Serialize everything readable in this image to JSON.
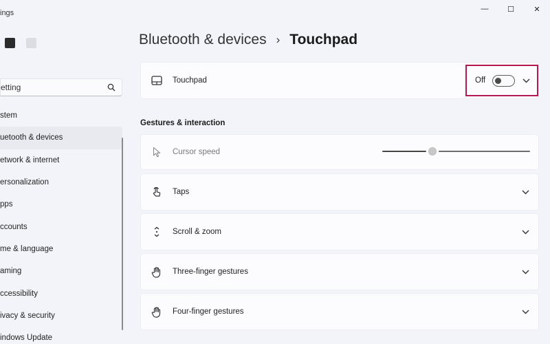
{
  "window": {
    "title": "ings",
    "controls": {
      "minimize": "—",
      "maximize": "☐",
      "close": "✕"
    }
  },
  "search": {
    "value": "etting",
    "icon": "search-icon"
  },
  "sidebar": {
    "items": [
      {
        "label": "stem",
        "selected": false
      },
      {
        "label": "uetooth & devices",
        "selected": true
      },
      {
        "label": "etwork & internet",
        "selected": false
      },
      {
        "label": "ersonalization",
        "selected": false
      },
      {
        "label": "pps",
        "selected": false
      },
      {
        "label": "ccounts",
        "selected": false
      },
      {
        "label": "me & language",
        "selected": false
      },
      {
        "label": "aming",
        "selected": false
      },
      {
        "label": "ccessibility",
        "selected": false
      },
      {
        "label": "ivacy & security",
        "selected": false
      },
      {
        "label": "indows Update",
        "selected": false
      }
    ]
  },
  "breadcrumb": {
    "parent": "Bluetooth & devices",
    "separator": "›",
    "current": "Touchpad"
  },
  "touchpad": {
    "label": "Touchpad",
    "toggle_state": "Off",
    "toggle_on": false,
    "icon": "touchpad-icon"
  },
  "section": {
    "heading": "Gestures & interaction"
  },
  "cursor_speed": {
    "label": "Cursor speed",
    "icon": "cursor-icon",
    "value_fraction": 0.34
  },
  "settings": [
    {
      "label": "Taps",
      "icon": "tap-icon"
    },
    {
      "label": "Scroll & zoom",
      "icon": "scroll-icon"
    },
    {
      "label": "Three-finger gestures",
      "icon": "hand-icon"
    },
    {
      "label": "Four-finger gestures",
      "icon": "hand-icon"
    }
  ],
  "colors": {
    "highlight": "#b3194f",
    "background": "#f3f4f9",
    "card": "#fcfcfe"
  }
}
